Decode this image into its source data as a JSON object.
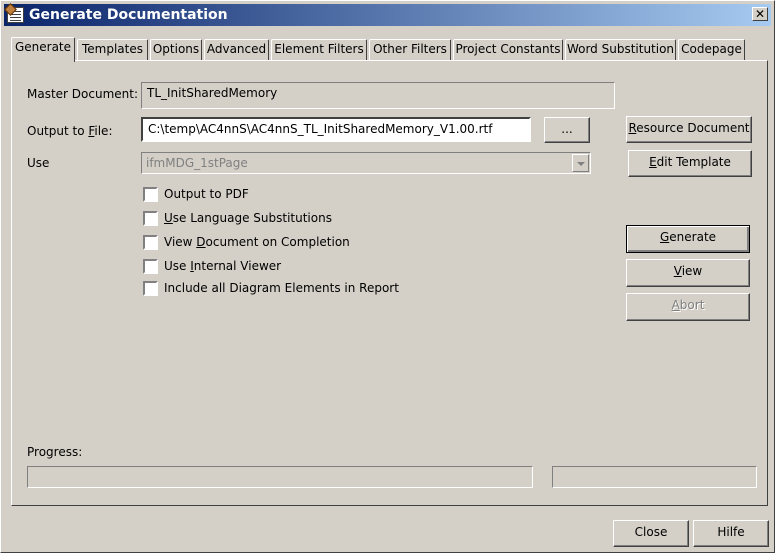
{
  "window": {
    "title": "Generate Documentation",
    "close_glyph": "✕"
  },
  "tabs": [
    {
      "label": "Generate",
      "active": true
    },
    {
      "label": "Templates"
    },
    {
      "label": "Options"
    },
    {
      "label": "Advanced"
    },
    {
      "label": "Element Filters"
    },
    {
      "label": "Other Filters"
    },
    {
      "label": "Project Constants"
    },
    {
      "label": "Word Substitution"
    },
    {
      "label": "Codepage"
    }
  ],
  "form": {
    "master_document_label": "Master Document:",
    "master_document_value": "TL_InitSharedMemory",
    "output_file_label_pre": "Output to ",
    "output_file_label_mnemonic": "F",
    "output_file_label_post": "ile:",
    "output_file_value": "C:\\temp\\AC4nnS\\AC4nnS_TL_InitSharedMemory_V1.00.rtf",
    "browse_label": "...",
    "use_label": "Use",
    "use_value": "ifmMDG_1stPage"
  },
  "options": [
    {
      "pre": "Output to PDF",
      "mn": "",
      "post": "",
      "checked": false
    },
    {
      "pre": "",
      "mn": "U",
      "post": "se Language Substitutions",
      "checked": false
    },
    {
      "pre": "View ",
      "mn": "D",
      "post": "ocument on Completion",
      "checked": false
    },
    {
      "pre": "Use ",
      "mn": "I",
      "post": "nternal Viewer",
      "checked": false
    },
    {
      "pre": "Include all Diagram Elements in Report",
      "mn": "",
      "post": "",
      "checked": false
    }
  ],
  "buttons": {
    "resource_pre": "",
    "resource_mn": "R",
    "resource_post": "esource Document",
    "edit_pre": "",
    "edit_mn": "E",
    "edit_post": "dit Template",
    "generate_pre": "",
    "generate_mn": "G",
    "generate_post": "enerate",
    "view_pre": "",
    "view_mn": "V",
    "view_post": "iew",
    "abort_pre": "",
    "abort_mn": "A",
    "abort_post": "bort",
    "close": "Close",
    "help": "Hilfe"
  },
  "progress": {
    "label": "Progress:"
  },
  "colors": {
    "face": "#d4d0c8",
    "title_start": "#0a246a",
    "title_end": "#a6caf0"
  }
}
